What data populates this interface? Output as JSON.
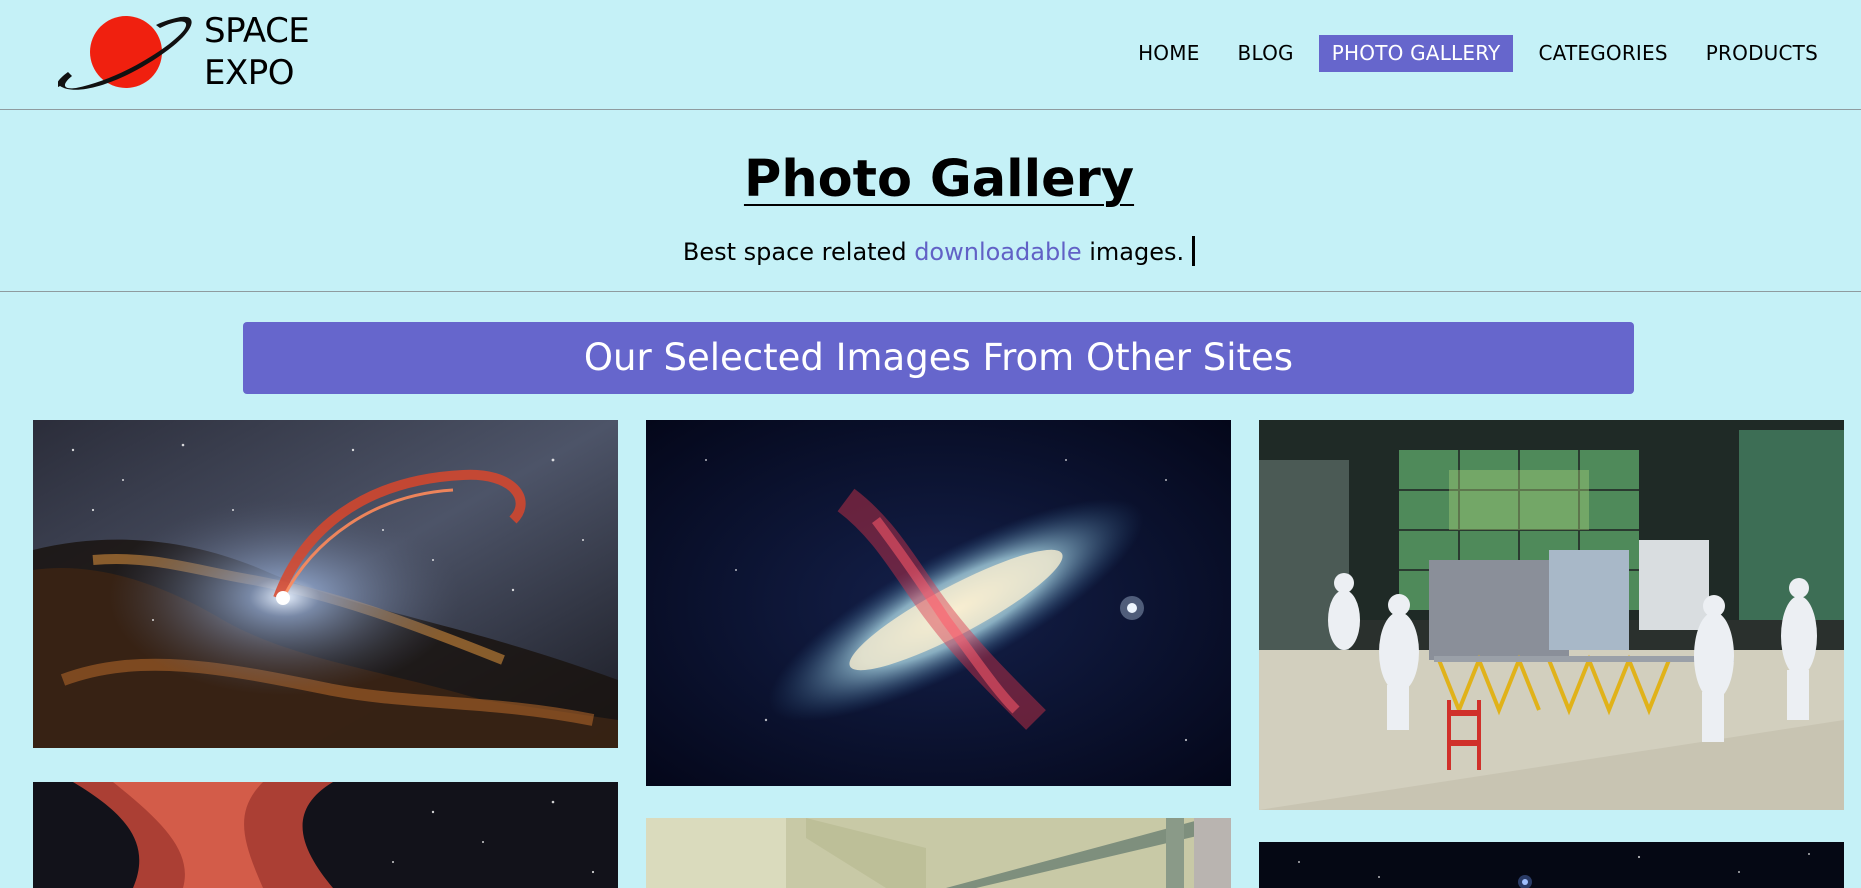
{
  "logo": {
    "line1": "SPACE",
    "line2": "EXPO",
    "planet_color": "#f0200f"
  },
  "nav": {
    "items": [
      {
        "label": "HOME"
      },
      {
        "label": "BLOG"
      },
      {
        "label": "PHOTO GALLERY",
        "active": true
      },
      {
        "label": "CATEGORIES"
      },
      {
        "label": "PRODUCTS"
      }
    ],
    "active_color": "#6666cc"
  },
  "hero": {
    "title": "Photo Gallery",
    "subtitle_before": "Best space related ",
    "subtitle_highlight": "downloadable",
    "subtitle_after": " images."
  },
  "banner": {
    "text": "Our Selected Images From Other Sites",
    "color": "#6666cc"
  },
  "gallery": {
    "images": [
      {
        "subject": "black hole tidal disruption"
      },
      {
        "subject": "starburst galaxy"
      },
      {
        "subject": "cleanroom spacecraft assembly"
      },
      {
        "subject": "red nebula"
      },
      {
        "subject": "facility interior"
      },
      {
        "subject": "star field"
      }
    ]
  },
  "colors": {
    "background": "#c5f1f7",
    "accent": "#6666cc",
    "link": "#6161c6"
  }
}
